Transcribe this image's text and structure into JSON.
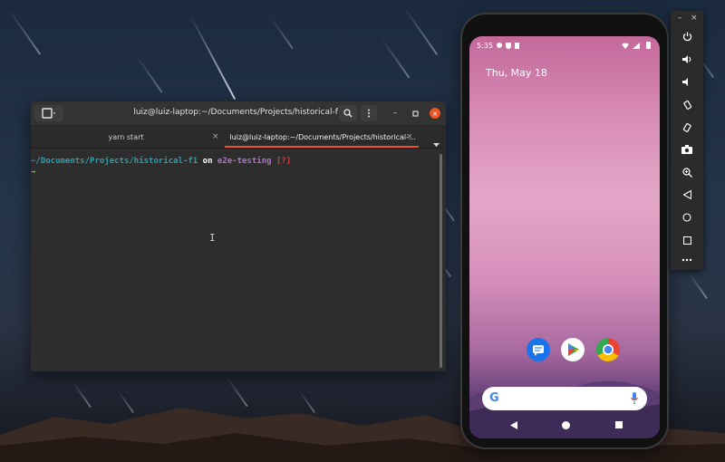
{
  "terminal": {
    "title": "luiz@luiz-laptop:~/Documents/Projects/historical-f1",
    "tabs": [
      {
        "label": "yarn start",
        "active": false
      },
      {
        "label": "luiz@luiz-laptop:~/Documents/Projects/historical-...",
        "active": true
      }
    ],
    "prompt": {
      "path": "~/Documents/Projects/historical-f1",
      "on": "on",
      "branch_icon": "",
      "branch": "e2e-testing",
      "status": "[?]",
      "arrow": "→"
    },
    "colors": {
      "path": "#2aa1b3",
      "branch": "#b073c8",
      "status": "#d23a3a",
      "arrow": "#5fb04b",
      "accent": "#e95420"
    }
  },
  "phone": {
    "status_time": "5:35",
    "date": "Thu, May 18",
    "dock_apps": [
      "messages-icon",
      "play-store-icon",
      "chrome-icon"
    ],
    "search_bar": {
      "logo": "G",
      "mic": "mic-icon"
    },
    "nav": [
      "back-icon",
      "home-icon",
      "recents-icon"
    ]
  },
  "emulator": {
    "window_controls": [
      "–",
      "×"
    ],
    "buttons": [
      "power-icon",
      "volume-up-icon",
      "volume-down-icon",
      "rotate-left-icon",
      "rotate-right-icon",
      "camera-icon",
      "zoom-icon",
      "back-icon",
      "home-icon",
      "overview-icon",
      "more-icon"
    ]
  }
}
